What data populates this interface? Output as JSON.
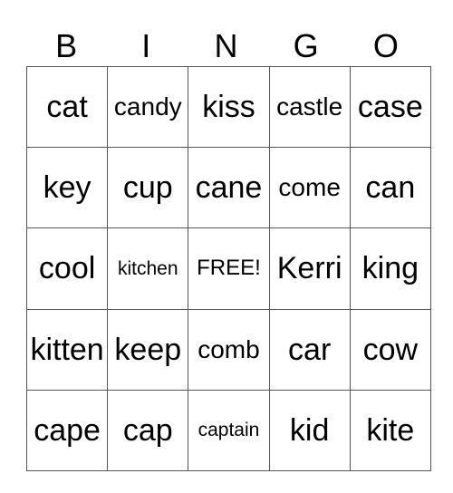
{
  "header": [
    "B",
    "I",
    "N",
    "G",
    "O"
  ],
  "rows": [
    [
      {
        "text": "cat",
        "size": "l"
      },
      {
        "text": "candy",
        "size": "m"
      },
      {
        "text": "kiss",
        "size": "l"
      },
      {
        "text": "castle",
        "size": "m"
      },
      {
        "text": "case",
        "size": "l"
      }
    ],
    [
      {
        "text": "key",
        "size": "l"
      },
      {
        "text": "cup",
        "size": "l"
      },
      {
        "text": "cane",
        "size": "l"
      },
      {
        "text": "come",
        "size": "m"
      },
      {
        "text": "can",
        "size": "l"
      }
    ],
    [
      {
        "text": "cool",
        "size": "l"
      },
      {
        "text": "kitchen",
        "size": "s"
      },
      {
        "text": "FREE!",
        "size": "f"
      },
      {
        "text": "Kerri",
        "size": "l"
      },
      {
        "text": "king",
        "size": "l"
      }
    ],
    [
      {
        "text": "kitten",
        "size": "l"
      },
      {
        "text": "keep",
        "size": "l"
      },
      {
        "text": "comb",
        "size": "m"
      },
      {
        "text": "car",
        "size": "l"
      },
      {
        "text": "cow",
        "size": "l"
      }
    ],
    [
      {
        "text": "cape",
        "size": "l"
      },
      {
        "text": "cap",
        "size": "l"
      },
      {
        "text": "captain",
        "size": "s"
      },
      {
        "text": "kid",
        "size": "l"
      },
      {
        "text": "kite",
        "size": "l"
      }
    ]
  ]
}
